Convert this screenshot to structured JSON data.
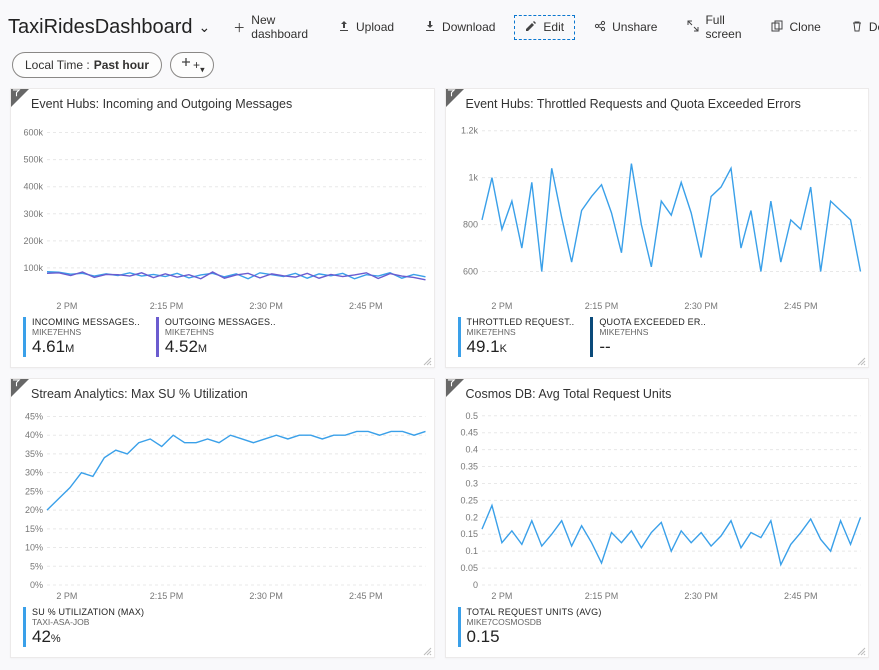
{
  "header": {
    "title": "TaxiRidesDashboard",
    "buttons": {
      "new_dashboard": "New dashboard",
      "upload": "Upload",
      "download": "Download",
      "edit": "Edit",
      "unshare": "Unshare",
      "full_screen": "Full screen",
      "clone": "Clone",
      "delete": "Delete"
    }
  },
  "filter": {
    "time_label": "Local Time :",
    "time_value": "Past hour"
  },
  "cards": {
    "c1": {
      "title": "Event Hubs: Incoming and Outgoing Messages",
      "legend": [
        {
          "label": "INCOMING MESSAGES..",
          "sub": "MIKE7EHNS",
          "value": "4.61",
          "unit": "M",
          "color": "#3aa0e9"
        },
        {
          "label": "OUTGOING MESSAGES..",
          "sub": "MIKE7EHNS",
          "value": "4.52",
          "unit": "M",
          "color": "#6b5ccf"
        }
      ]
    },
    "c2": {
      "title": "Event Hubs: Throttled Requests and Quota Exceeded Errors",
      "legend": [
        {
          "label": "THROTTLED REQUEST..",
          "sub": "MIKE7EHNS",
          "value": "49.1",
          "unit": "K",
          "color": "#3aa0e9"
        },
        {
          "label": "QUOTA EXCEEDED ER..",
          "sub": "MIKE7EHNS",
          "value": "--",
          "unit": "",
          "color": "#0a4a7a"
        }
      ]
    },
    "c3": {
      "title": "Stream Analytics: Max SU % Utilization",
      "legend": [
        {
          "label": "SU % UTILIZATION (MAX)",
          "sub": "TAXI-ASA-JOB",
          "value": "42",
          "unit": "%",
          "color": "#3aa0e9"
        }
      ]
    },
    "c4": {
      "title": "Cosmos DB: Avg Total Request Units",
      "legend": [
        {
          "label": "TOTAL REQUEST UNITS (AVG)",
          "sub": "MIKE7COSMOSDB",
          "value": "0.15",
          "unit": "",
          "color": "#3aa0e9"
        }
      ]
    }
  },
  "chart_data": [
    {
      "id": "c1",
      "type": "line",
      "title": "Event Hubs: Incoming and Outgoing Messages",
      "x_ticks": [
        "2 PM",
        "2:15 PM",
        "2:30 PM",
        "2:45 PM"
      ],
      "y_ticks": [
        100000,
        200000,
        300000,
        400000,
        500000,
        600000
      ],
      "y_tick_labels": [
        "100k",
        "200k",
        "300k",
        "400k",
        "500k",
        "600k"
      ],
      "ylim": [
        0,
        650000
      ],
      "series": [
        {
          "name": "Incoming Messages",
          "color": "#3aa0e9",
          "values": [
            86000,
            84000,
            77000,
            80000,
            70000,
            78000,
            72000,
            82000,
            70000,
            76000,
            68000,
            80000,
            63000,
            74000,
            80000,
            67000,
            78000,
            60000,
            82000,
            75000,
            68000,
            80000,
            62000,
            78000,
            71000,
            80000,
            60000,
            75000,
            70000,
            82000,
            62000,
            76000,
            67000
          ]
        },
        {
          "name": "Outgoing Messages",
          "color": "#6b5ccf",
          "values": [
            80000,
            82000,
            72000,
            85000,
            65000,
            76000,
            75000,
            70000,
            82000,
            64000,
            78000,
            66000,
            75000,
            60000,
            85000,
            62000,
            74000,
            80000,
            63000,
            78000,
            71000,
            66000,
            80000,
            62000,
            76000,
            68000,
            74000,
            82000,
            61000,
            79000,
            70000,
            65000,
            56000
          ]
        }
      ]
    },
    {
      "id": "c2",
      "type": "line",
      "title": "Event Hubs: Throttled Requests and Quota Exceeded Errors",
      "x_ticks": [
        "2 PM",
        "2:15 PM",
        "2:30 PM",
        "2:45 PM"
      ],
      "y_ticks": [
        600,
        800,
        1000,
        1200
      ],
      "y_tick_labels": [
        "600",
        "800",
        "1k",
        "1.2k"
      ],
      "ylim": [
        500,
        1250
      ],
      "series": [
        {
          "name": "Throttled Requests",
          "color": "#3aa0e9",
          "values": [
            820,
            1000,
            780,
            900,
            700,
            980,
            600,
            1040,
            830,
            640,
            860,
            920,
            970,
            850,
            680,
            1060,
            800,
            620,
            900,
            840,
            980,
            850,
            660,
            920,
            960,
            1040,
            700,
            860,
            600,
            900,
            640,
            820,
            780,
            960,
            600,
            900,
            860,
            820,
            600
          ]
        }
      ]
    },
    {
      "id": "c3",
      "type": "line",
      "title": "Stream Analytics: Max SU % Utilization",
      "x_ticks": [
        "2 PM",
        "2:15 PM",
        "2:30 PM",
        "2:45 PM"
      ],
      "y_ticks": [
        0,
        5,
        10,
        15,
        20,
        25,
        30,
        35,
        40,
        45
      ],
      "y_tick_labels": [
        "0%",
        "5%",
        "10%",
        "15%",
        "20%",
        "25%",
        "30%",
        "35%",
        "40%",
        "45%"
      ],
      "ylim": [
        0,
        47
      ],
      "series": [
        {
          "name": "SU % Utilization (Max)",
          "color": "#3aa0e9",
          "values": [
            20,
            23,
            26,
            30,
            29,
            34,
            36,
            35,
            38,
            39,
            37,
            40,
            38,
            38,
            39,
            38,
            40,
            39,
            38,
            39,
            40,
            39,
            40,
            40,
            39,
            40,
            40,
            41,
            41,
            40,
            41,
            41,
            40,
            41
          ]
        }
      ]
    },
    {
      "id": "c4",
      "type": "line",
      "title": "Cosmos DB: Avg Total Request Units",
      "x_ticks": [
        "2 PM",
        "2:15 PM",
        "2:30 PM",
        "2:45 PM"
      ],
      "y_ticks": [
        0,
        0.05,
        0.1,
        0.15,
        0.2,
        0.25,
        0.3,
        0.35,
        0.4,
        0.45,
        0.5
      ],
      "y_tick_labels": [
        "0",
        "0.05",
        "0.1",
        "0.15",
        "0.2",
        "0.25",
        "0.3",
        "0.35",
        "0.4",
        "0.45",
        "0.5"
      ],
      "ylim": [
        0,
        0.52
      ],
      "series": [
        {
          "name": "Total Request Units (Avg)",
          "color": "#3aa0e9",
          "values": [
            0.165,
            0.235,
            0.125,
            0.16,
            0.12,
            0.19,
            0.115,
            0.15,
            0.19,
            0.115,
            0.175,
            0.125,
            0.065,
            0.155,
            0.125,
            0.16,
            0.11,
            0.155,
            0.185,
            0.1,
            0.16,
            0.125,
            0.155,
            0.115,
            0.145,
            0.19,
            0.11,
            0.155,
            0.14,
            0.19,
            0.06,
            0.12,
            0.155,
            0.195,
            0.135,
            0.1,
            0.19,
            0.12,
            0.2
          ]
        }
      ]
    }
  ]
}
